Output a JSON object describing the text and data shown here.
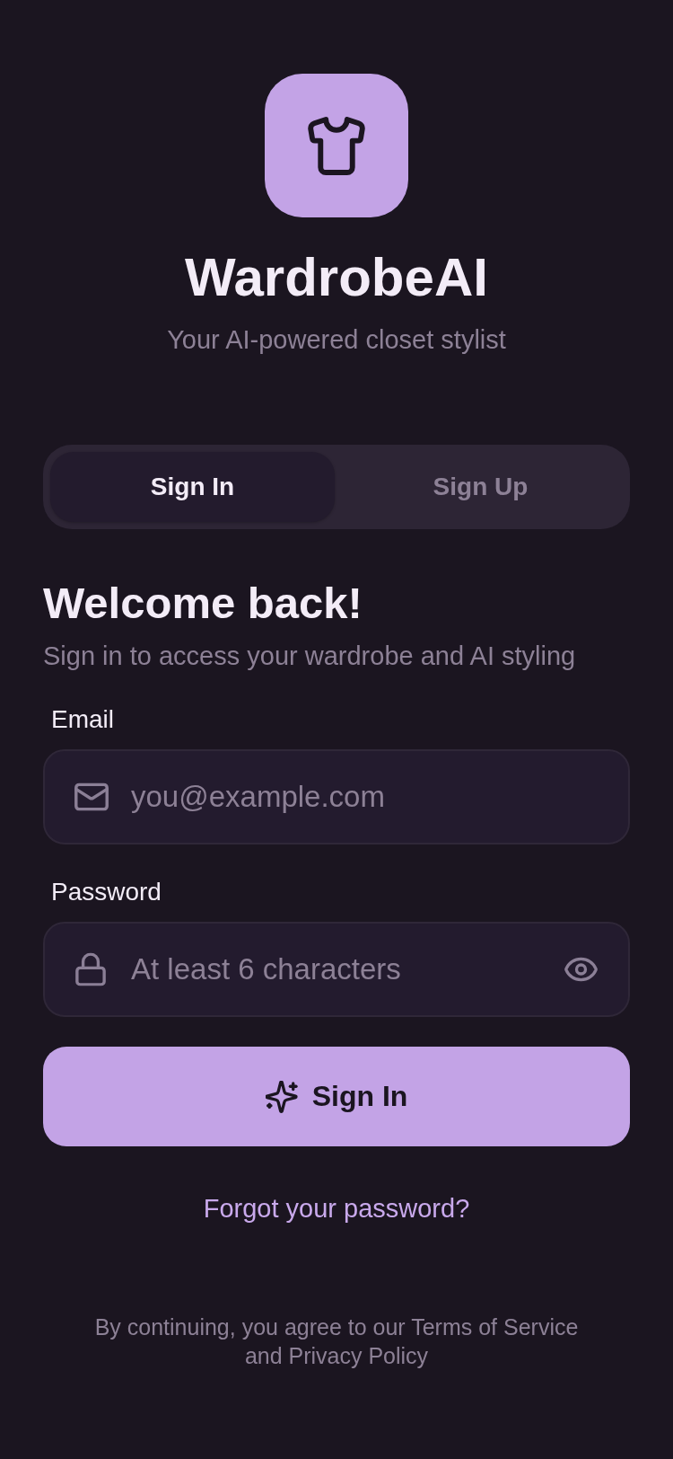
{
  "app": {
    "name": "WardrobeAI",
    "tagline": "Your AI-powered closet stylist"
  },
  "tabs": [
    {
      "label": "Sign In",
      "selected": true
    },
    {
      "label": "Sign Up",
      "selected": false
    }
  ],
  "heading": "Welcome back!",
  "subheading": "Sign in to access your wardrobe and AI styling",
  "fields": [
    {
      "kind": "email",
      "label": "Email",
      "placeholder": "you@example.com"
    },
    {
      "kind": "password",
      "label": "Password",
      "placeholder": "At least 6 characters"
    }
  ],
  "submit": {
    "label": "Sign In"
  },
  "forgot_link": "Forgot your password?",
  "legal": "By continuing, you agree to our Terms of Service and Privacy Policy"
}
